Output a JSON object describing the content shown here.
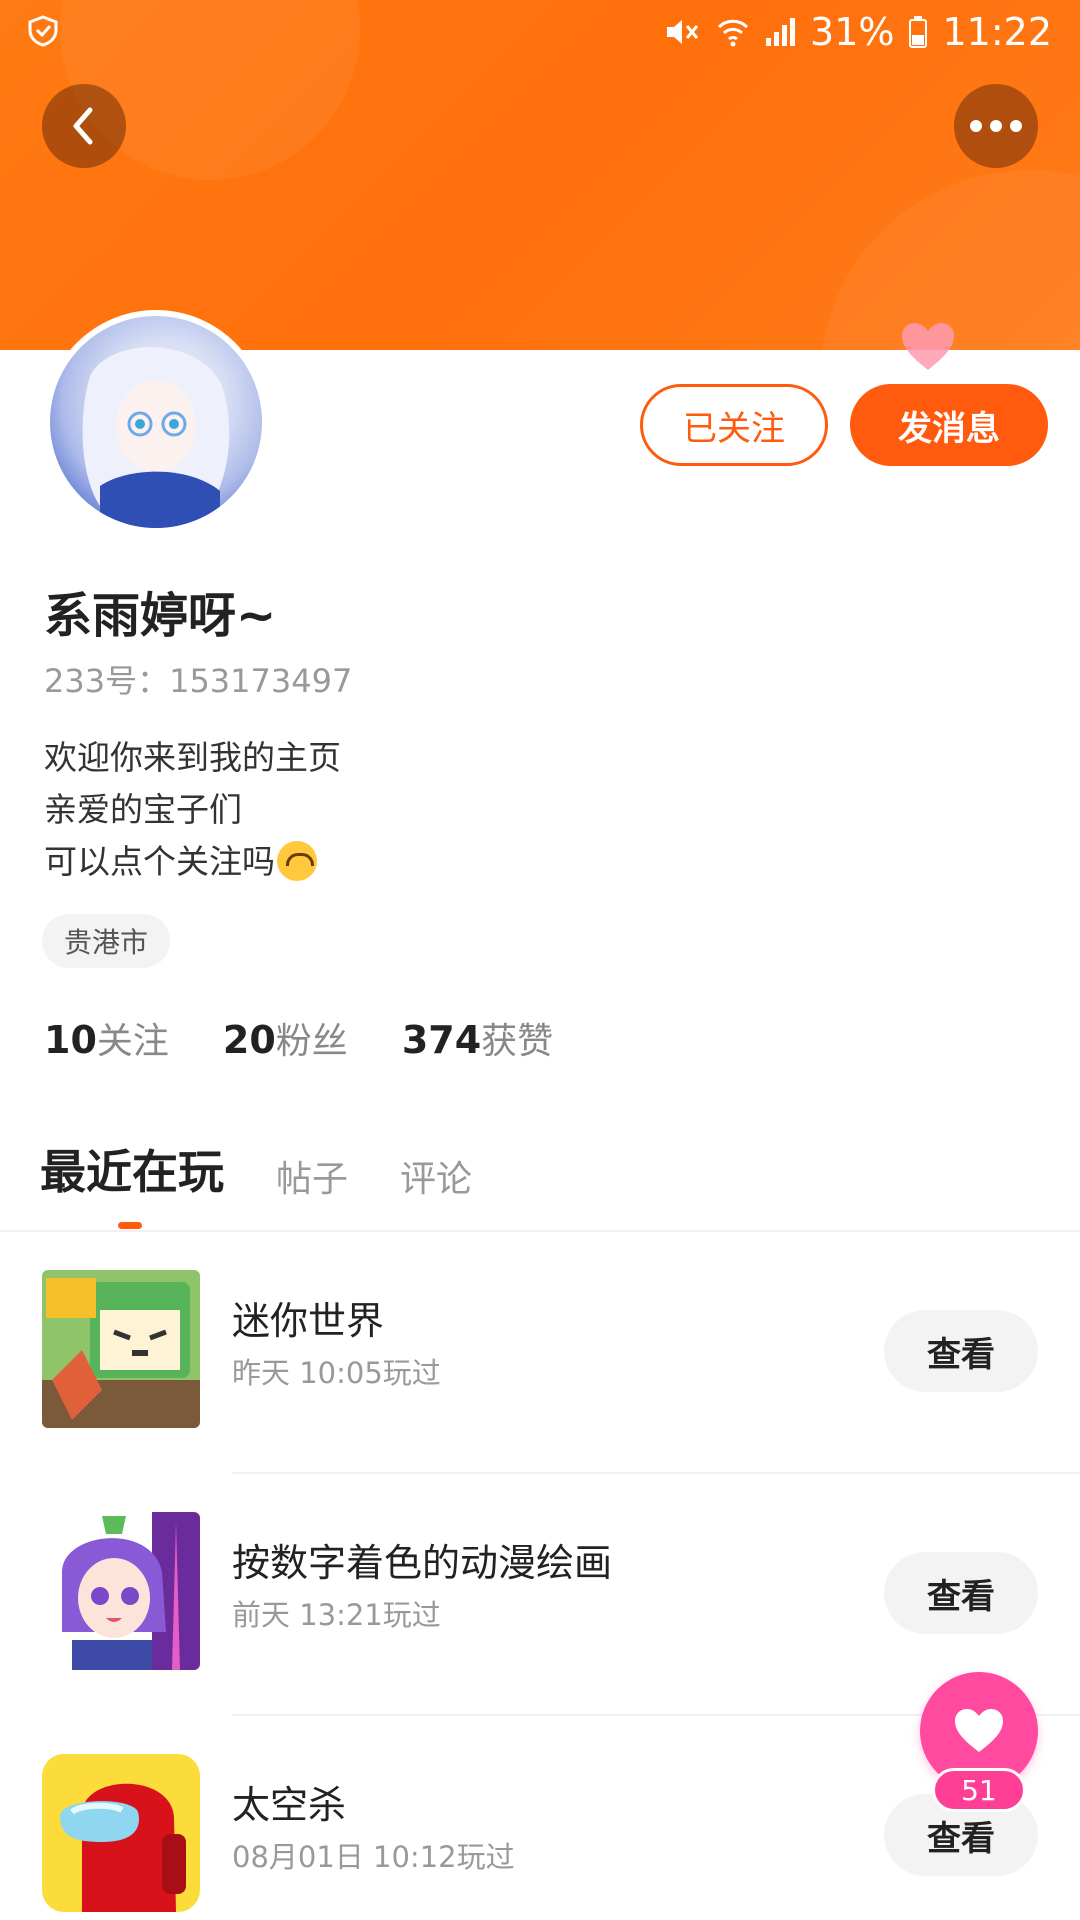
{
  "status_bar": {
    "battery": "31%",
    "time": "11:22"
  },
  "profile": {
    "name": "系雨婷呀~",
    "id_text": "233号：153173497",
    "bio_lines": [
      "欢迎你来到我的主页",
      "亲爱的宝子们",
      "可以点个关注吗"
    ],
    "location": "贵港市",
    "follow_button": "已关注",
    "message_button": "发消息"
  },
  "stats": [
    {
      "num": "10",
      "label": "关注"
    },
    {
      "num": "20",
      "label": "粉丝"
    },
    {
      "num": "374",
      "label": "获赞"
    }
  ],
  "tabs": [
    "最近在玩",
    "帖子",
    "评论"
  ],
  "games": [
    {
      "title": "迷你世界",
      "time": "昨天 10:05玩过",
      "button": "查看"
    },
    {
      "title": "按数字着色的动漫绘画",
      "time": "前天 13:21玩过",
      "button": "查看"
    },
    {
      "title": "太空杀",
      "time": "08月01日 10:12玩过",
      "button": "查看"
    }
  ],
  "like_fab": {
    "count": "51"
  },
  "colors": {
    "accent": "#ff5a0d",
    "banner": "#ff7a12",
    "like": "#ff4aa0"
  }
}
